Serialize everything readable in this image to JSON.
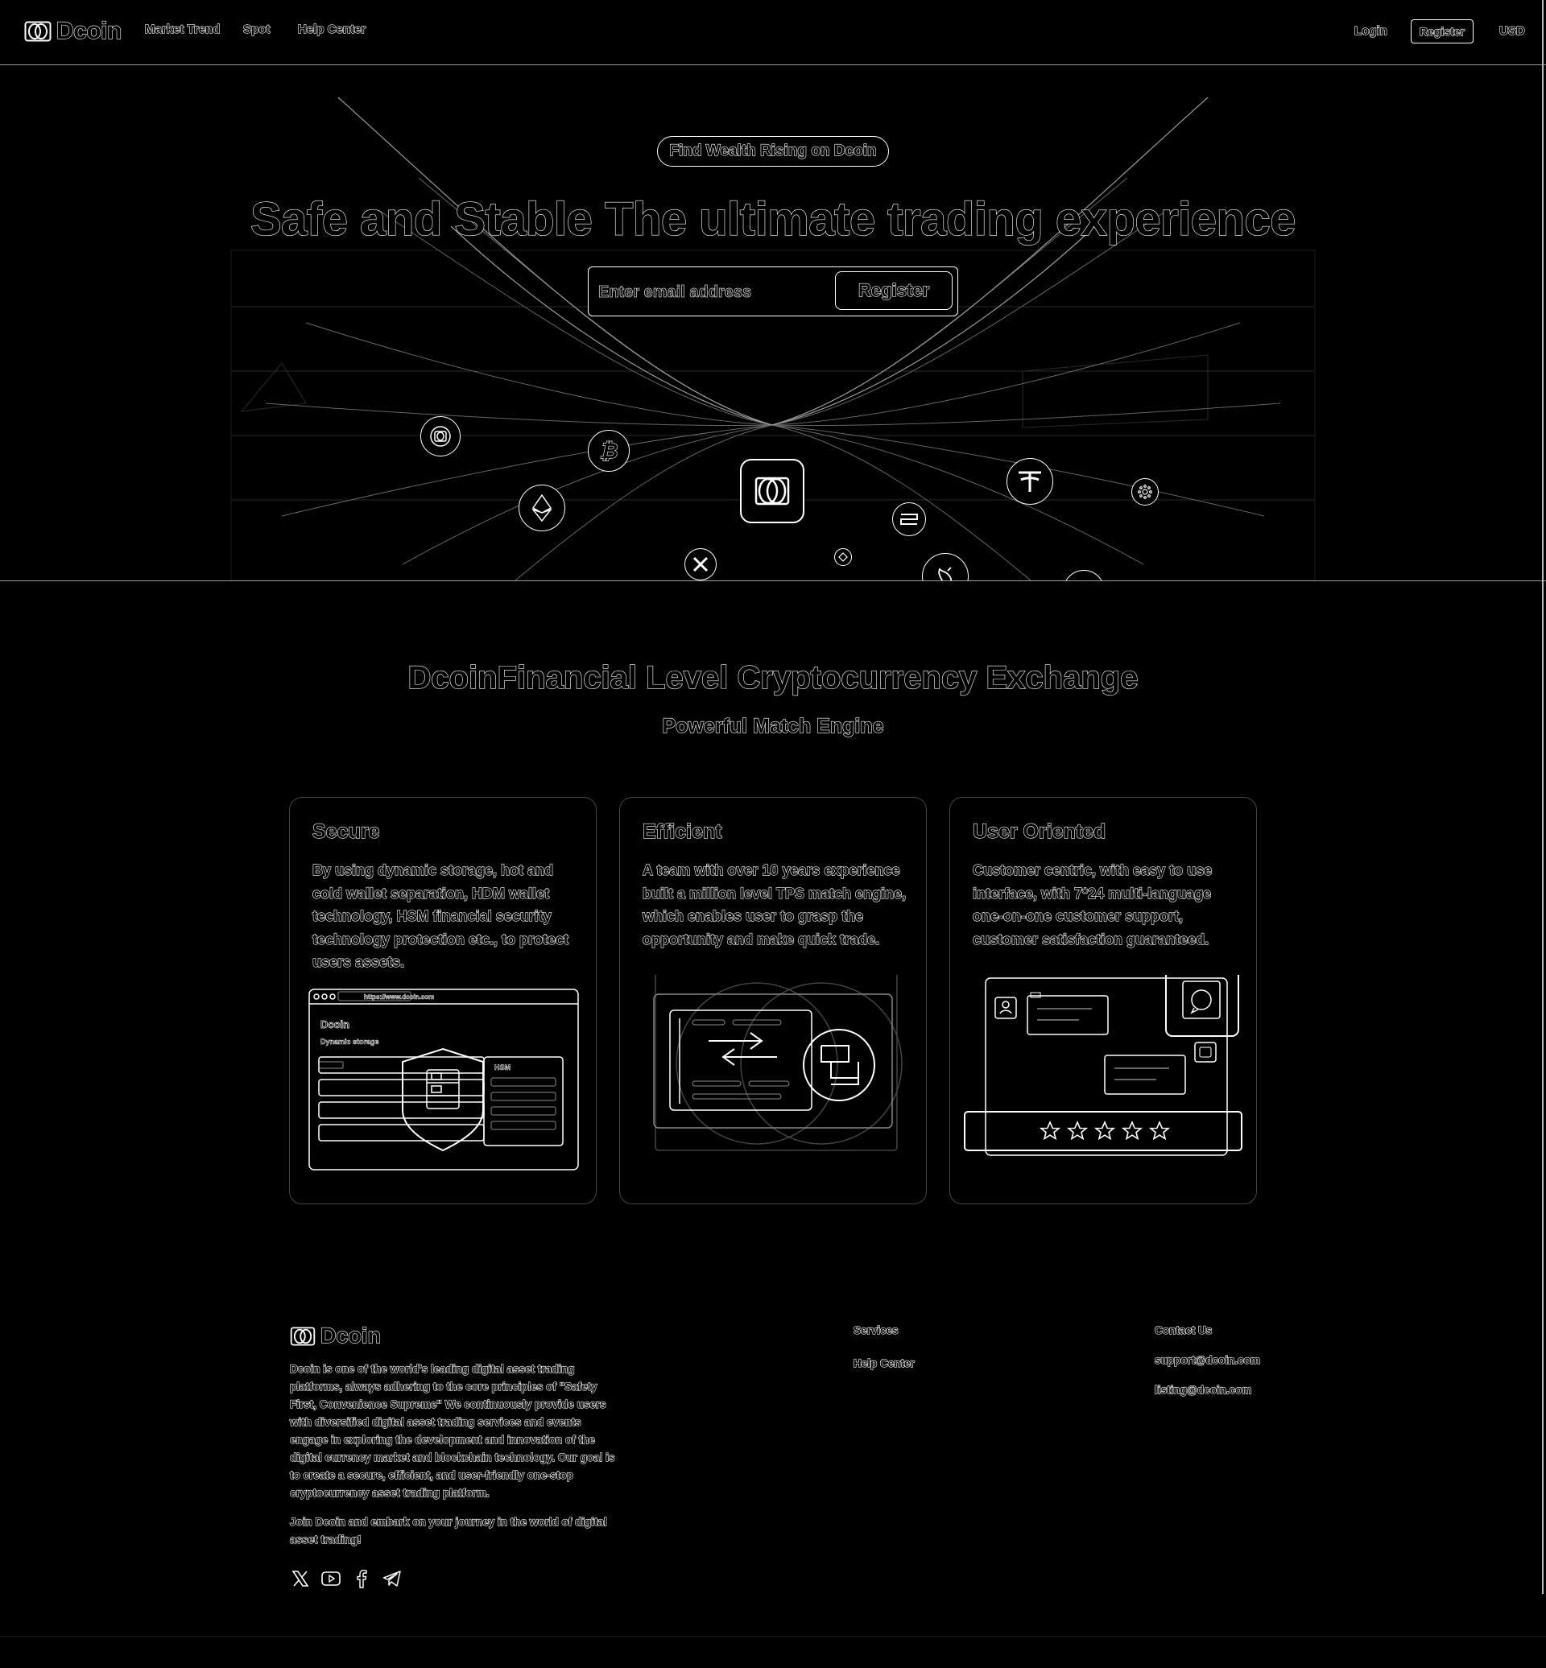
{
  "header": {
    "brand": "Dcoin",
    "nav": [
      {
        "label": "Market Trend"
      },
      {
        "label": "Spot"
      },
      {
        "label": "Help Center"
      }
    ],
    "login": "Login",
    "register": "Register",
    "currency": "USD"
  },
  "hero": {
    "badge": "Find Wealth Rising on Dcoin",
    "title": "Safe and Stable The ultimate trading experience",
    "email_placeholder": "Enter email address",
    "register_button": "Register",
    "coins": [
      "dcoin-coin",
      "bitcoin-coin",
      "ethereum-coin",
      "xrp-coin",
      "dcoin-center",
      "small-coin",
      "stacks-coin",
      "tether-coin",
      "uniswap-coin",
      "polkadot-coin",
      "cardano-coin"
    ]
  },
  "section": {
    "title": "DcoinFinancial Level Cryptocurrency Exchange",
    "subtitle": "Powerful Match Engine",
    "cards": [
      {
        "title": "Secure",
        "text": "By using dynamic storage, hot and cold wallet separation, HDM wallet technology, HSM financial security technology protection etc., to protect users assets.",
        "ill_url": "https://www.dcoin.com",
        "ill_brand": "Dcoin",
        "ill_storage": "Dynamic storage",
        "ill_hsm": "HSM"
      },
      {
        "title": "Efficient",
        "text": "A team with over 10 years experience built a million level TPS match engine, which enables user to grasp the opportunity and make quick trade."
      },
      {
        "title": "User Oriented",
        "text": "Customer centric, with easy to use interface, with 7*24 multi-language one-on-one customer support, customer satisfaction guaranteed."
      }
    ]
  },
  "footer": {
    "brand": "Dcoin",
    "description": "Dcoin is one of the world's leading digital asset trading platforms, always adhering to the core principles of \"Safety First, Convenience Supreme\" We continuously provide users with diversified digital asset trading services and events engage in exploring the development and innovation of the digital currency market and blockchain technology. Our goal is to create a secure, efficient, and user-friendly one-stop cryptocurrency asset trading platform.",
    "join": "Join Dcoin and embark on your journey in the world of digital asset trading!",
    "services_heading": "Services",
    "services": [
      "Help Center"
    ],
    "contact_heading": "Contact Us",
    "contacts": [
      "support@dcoin.com",
      "listing@dcoin.com"
    ],
    "social": [
      "x-icon",
      "youtube-icon",
      "facebook-icon",
      "telegram-icon"
    ]
  }
}
